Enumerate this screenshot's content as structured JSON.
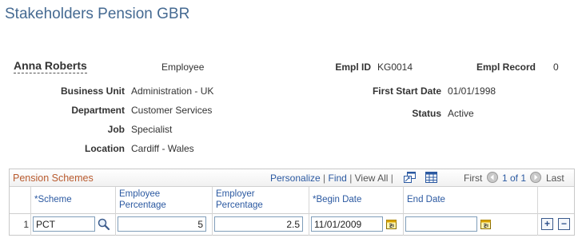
{
  "page": {
    "title": "Stakeholders Pension GBR"
  },
  "employee": {
    "name": "Anna Roberts",
    "type": "Employee",
    "empl_id_label": "Empl ID",
    "empl_id": "KG0014",
    "empl_record_label": "Empl Record",
    "empl_record": "0",
    "business_unit_label": "Business Unit",
    "business_unit": "Administration - UK",
    "first_start_date_label": "First Start Date",
    "first_start_date": "01/01/1998",
    "department_label": "Department",
    "department": "Customer Services",
    "status_label": "Status",
    "status": "Active",
    "job_label": "Job",
    "job": "Specialist",
    "location_label": "Location",
    "location": "Cardiff - Wales"
  },
  "grid": {
    "title": "Pension Schemes",
    "personalize": "Personalize",
    "find": "Find",
    "view_all": "View All",
    "first": "First",
    "range": "1 of 1",
    "last": "Last",
    "columns": {
      "scheme": "*Scheme",
      "employee_pct_1": "Employee",
      "employee_pct_2": "Percentage",
      "employer_pct_1": "Employer",
      "employer_pct_2": "Percentage",
      "begin_date": "*Begin Date",
      "end_date": "End Date"
    },
    "rows": [
      {
        "num": "1",
        "scheme": "PCT",
        "employee_pct": "5",
        "employer_pct": "2.5",
        "begin_date": "11/01/2009",
        "end_date": ""
      }
    ]
  }
}
